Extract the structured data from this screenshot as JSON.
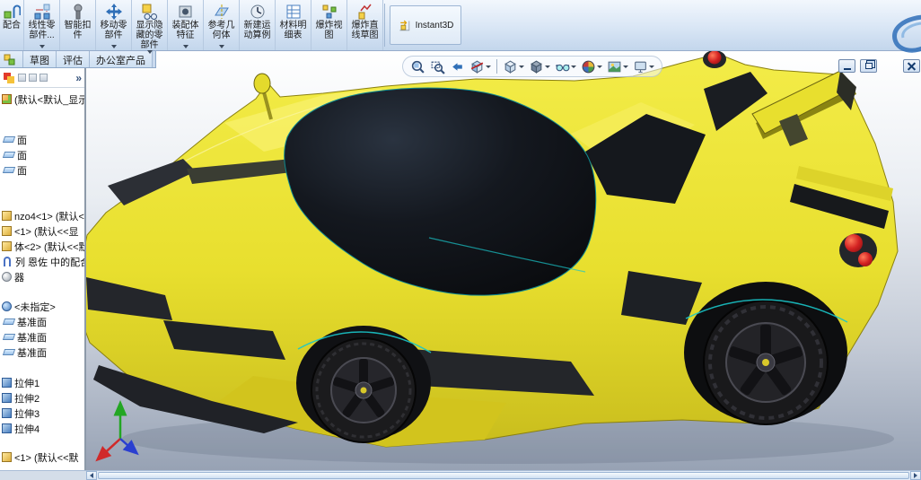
{
  "toolbar": {
    "buttons": [
      {
        "label": "配合",
        "icon": "mate-icon",
        "dropdown": false
      },
      {
        "label": "线性零部件...",
        "icon": "linear-component-pattern-icon",
        "dropdown": true
      },
      {
        "label": "智能扣件",
        "icon": "smart-fasteners-icon",
        "dropdown": false
      },
      {
        "label": "移动零部件",
        "icon": "move-component-icon",
        "dropdown": true
      },
      {
        "label": "显示隐藏的零部件",
        "icon": "show-hidden-components-icon",
        "dropdown": true
      },
      {
        "label": "装配体特征",
        "icon": "assembly-features-icon",
        "dropdown": true
      },
      {
        "label": "参考几何体",
        "icon": "reference-geometry-icon",
        "dropdown": true
      },
      {
        "label": "新建运动算例",
        "icon": "new-motion-study-icon",
        "dropdown": false
      },
      {
        "label": "材料明细表",
        "icon": "bill-of-materials-icon",
        "dropdown": false
      },
      {
        "label": "爆炸视图",
        "icon": "exploded-view-icon",
        "dropdown": false
      },
      {
        "label": "爆炸直线草图",
        "icon": "explode-line-sketch-icon",
        "dropdown": false
      },
      {
        "label": "Instant3D",
        "icon": "instant3d-icon",
        "dropdown": false
      }
    ]
  },
  "tabs": {
    "items": [
      {
        "label": "",
        "icon": "assembly-tab-icon"
      },
      {
        "label": "草图",
        "icon": ""
      },
      {
        "label": "评估",
        "icon": ""
      },
      {
        "label": "办公室产品",
        "icon": ""
      }
    ]
  },
  "panel": {
    "chevron": "»",
    "tree": {
      "items": [
        {
          "text": "(默认<默认_显示",
          "icon": "assembly-icon"
        },
        {
          "text": "面",
          "icon": "plane-icon"
        },
        {
          "text": "面",
          "icon": "plane-icon"
        },
        {
          "text": "面",
          "icon": "plane-icon"
        },
        {
          "text": "nzo4<1> (默认<<默",
          "icon": "component-icon"
        },
        {
          "text": "<1> (默认<<显",
          "icon": "component-icon"
        },
        {
          "text": "体<2> (默认<<默",
          "icon": "component-icon"
        },
        {
          "text": "列 恩佐 中的配合",
          "icon": "mates-folder-icon"
        },
        {
          "text": "器",
          "icon": "sensor-icon"
        },
        {
          "text": "<未指定>",
          "icon": "material-icon"
        },
        {
          "text": "基准面",
          "icon": "plane-icon"
        },
        {
          "text": "基准面",
          "icon": "plane-icon"
        },
        {
          "text": "基准面",
          "icon": "plane-icon"
        },
        {
          "text": "拉伸1",
          "icon": "extrude-icon"
        },
        {
          "text": "拉伸2",
          "icon": "extrude-icon"
        },
        {
          "text": "拉伸3",
          "icon": "extrude-icon"
        },
        {
          "text": "拉伸4",
          "icon": "extrude-icon"
        },
        {
          "text": "<1> (默认<<默",
          "icon": "component-icon"
        }
      ]
    }
  },
  "headsup": {
    "tools": [
      {
        "icon": "zoom-fit-icon",
        "dropdown": false
      },
      {
        "icon": "zoom-area-icon",
        "dropdown": false
      },
      {
        "icon": "previous-view-icon",
        "dropdown": false
      },
      {
        "icon": "section-view-icon",
        "dropdown": true
      },
      {
        "icon": "view-orientation-icon",
        "dropdown": true
      },
      {
        "icon": "display-style-icon",
        "dropdown": true
      },
      {
        "icon": "hide-show-items-icon",
        "dropdown": true
      },
      {
        "icon": "edit-appearance-icon",
        "dropdown": true
      },
      {
        "icon": "apply-scene-icon",
        "dropdown": true
      },
      {
        "icon": "view-settings-icon",
        "dropdown": true
      }
    ]
  },
  "window_controls": [
    {
      "icon": "minimize-icon"
    },
    {
      "icon": "restore-icon"
    },
    {
      "icon": "close-icon"
    }
  ],
  "brand": {
    "icon": "dassault-3ds-logo-icon"
  },
  "scene": {
    "model": "yellow Enzo-style sports car assembly, upper front-left 3/4 view",
    "colors": {
      "body_yellow": "#e8df2e",
      "canopy_black": "#101216",
      "edge_teal": "#19c5c9",
      "taillight_red": "#d42222",
      "background_top": "#ffffff",
      "background_bottom": "#97a2b4",
      "triad_x": "#d02a2a",
      "triad_y": "#23a623",
      "triad_z": "#2a3fd0"
    }
  }
}
